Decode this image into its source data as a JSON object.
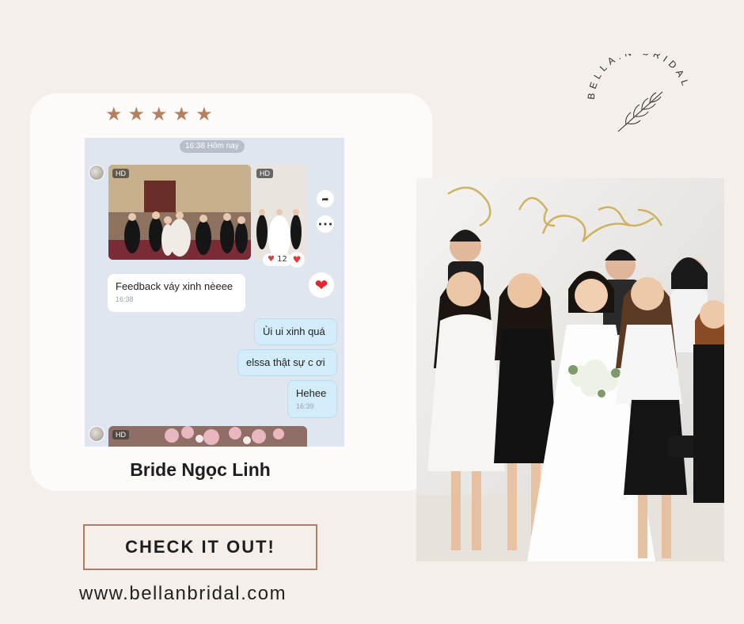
{
  "brand": {
    "logo_text": "BELLA.N BRIDAL"
  },
  "rating": {
    "stars": 5,
    "max": 5,
    "star_glyph": "★"
  },
  "chat": {
    "header_time": "16:38 Hôm nay",
    "photo_badge": "HD",
    "reaction_count": "12",
    "messages": [
      {
        "text": "Feedback váy xinh nèeee",
        "time": "16:38",
        "side": "in"
      },
      {
        "text": "Ùi ui xinh quá",
        "time": "",
        "side": "out"
      },
      {
        "text": "elssa thật sự c ơi",
        "time": "",
        "side": "out"
      },
      {
        "text": "Hehee",
        "time": "16:39",
        "side": "out"
      }
    ]
  },
  "caption": "Bride Ngọc Linh",
  "cta_label": "CHECK IT OUT!",
  "website": "www.bellanbridal.com",
  "colors": {
    "background": "#f4efeb",
    "accent": "#b37d5c",
    "card": "#fcfbfa",
    "chat_bg": "#dfe6ef"
  }
}
